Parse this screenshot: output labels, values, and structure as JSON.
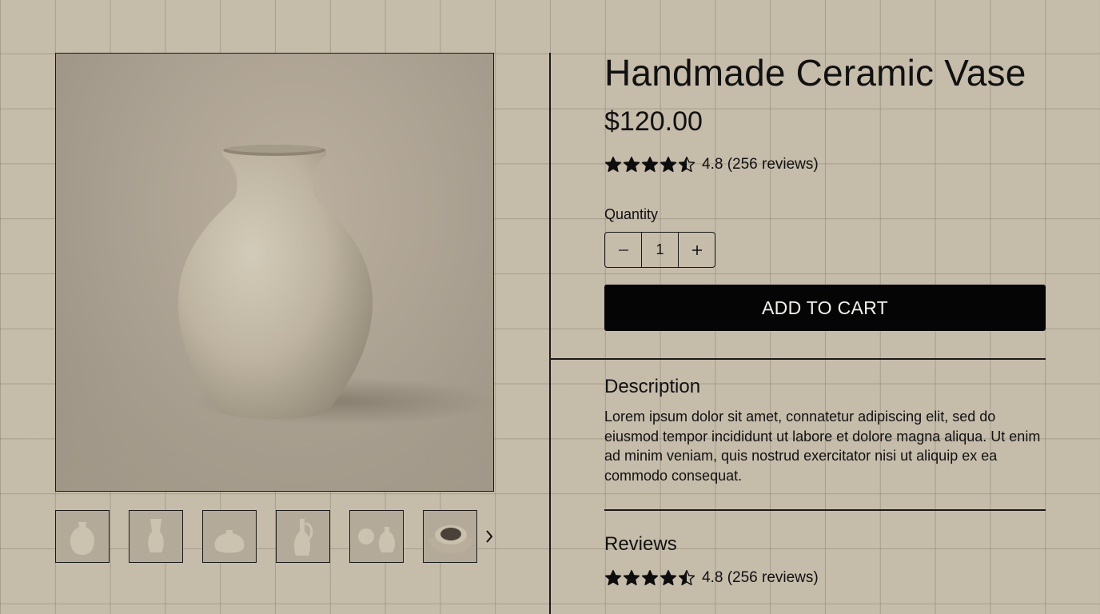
{
  "product": {
    "title": "Handmade Ceramic Vase",
    "price": "$120.00",
    "rating": 4.5,
    "rating_text": "4.8 (256 reviews)"
  },
  "quantity": {
    "label": "Quantity",
    "value": "1",
    "decrement_icon": "minus-icon",
    "increment_icon": "plus-icon"
  },
  "cart": {
    "button_label": "ADD TO CART"
  },
  "description": {
    "heading": "Description",
    "body": "Lorem ipsum dolor sit amet, connatetur adipiscing elit, sed do eiusmod tempor incididunt ut labore et dolore magna aliqua. Ut enim ad minim veniam, quis nostrud exercitator nisi ut aliquip ex ea  commodo consequat."
  },
  "reviews": {
    "heading": "Reviews",
    "rating": 4.5,
    "rating_text": "4.8 (256 reviews)"
  },
  "gallery": {
    "thumbnails": [
      "vase-round",
      "vase-tall-cylinder",
      "vase-squat",
      "jug-handle",
      "vase-pair",
      "bowl-wide"
    ],
    "next_icon": "chevron-right-icon"
  },
  "colors": {
    "background": "#c5bcaa",
    "button": "#050505",
    "button_text": "#f2f0ea",
    "vase": "#c9c0ae"
  }
}
